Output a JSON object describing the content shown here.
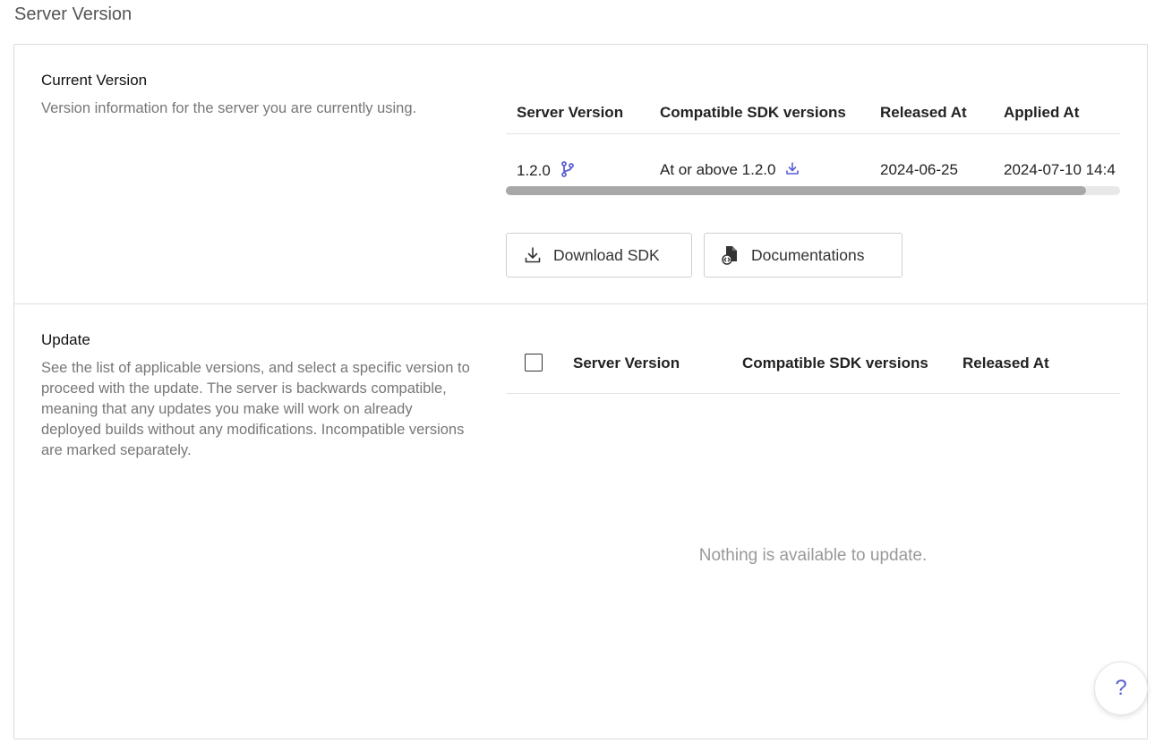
{
  "page": {
    "title": "Server Version"
  },
  "current": {
    "title": "Current Version",
    "description": "Version information for the server you are currently using.",
    "table": {
      "headers": [
        "Server Version",
        "Compatible SDK versions",
        "Released At",
        "Applied At"
      ],
      "row": {
        "server_version": "1.2.0",
        "sdk": "At or above 1.2.0",
        "released_at": "2024-06-25",
        "applied_at": "2024-07-10 14:4"
      }
    },
    "buttons": {
      "download_sdk": "Download SDK",
      "documentations": "Documentations"
    }
  },
  "update": {
    "title": "Update",
    "description": "See the list of applicable versions, and select a specific version to proceed with the update. The server is backwards compatible, meaning that any updates you make will work on already deployed builds without any modifications. Incompatible versions are marked separately.",
    "table": {
      "headers": [
        "Server Version",
        "Compatible SDK versions",
        "Released At"
      ]
    },
    "empty_message": "Nothing is available to update."
  },
  "help": {
    "label": "?"
  },
  "colors": {
    "accent": "#5a5fd1",
    "border": "#dcdcdc",
    "muted_text": "#777777"
  },
  "icons": {
    "branch": "git-branch-icon",
    "download": "download-icon",
    "docs": "document-code-icon",
    "help": "question-icon"
  }
}
